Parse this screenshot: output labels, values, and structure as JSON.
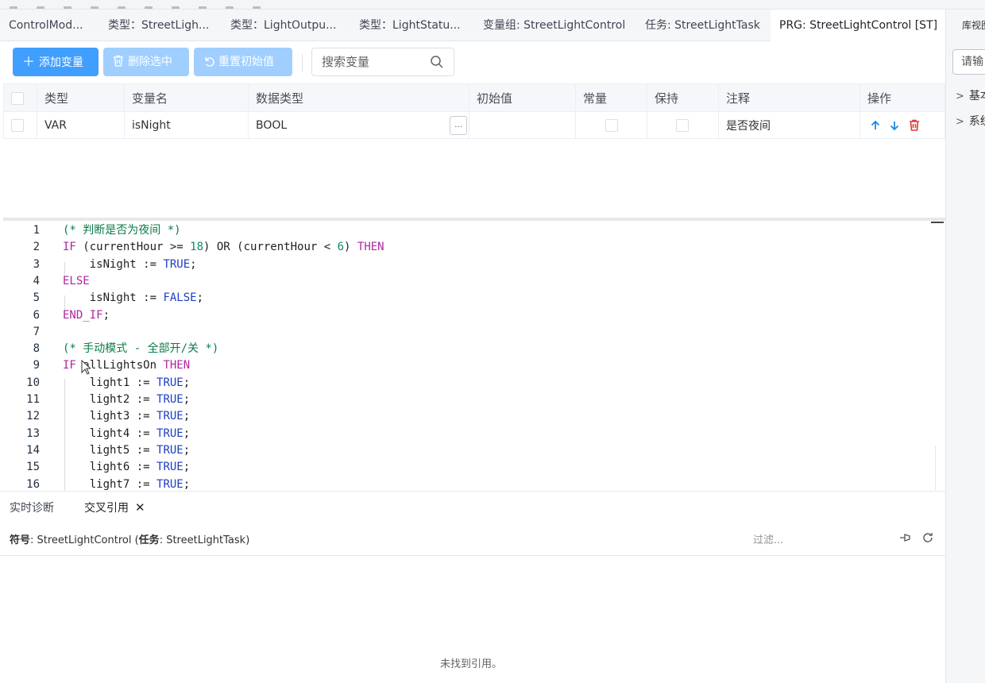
{
  "tabs": [
    {
      "label": "ControlMod..."
    },
    {
      "label": "类型：StreetLigh..."
    },
    {
      "label": "类型：LightOutpu..."
    },
    {
      "label": "类型：LightStatu..."
    },
    {
      "label": "变量组: StreetLightControl"
    },
    {
      "label": "任务: StreetLightTask"
    },
    {
      "label": "PRG: StreetLightControl [ST]"
    }
  ],
  "right_panel": {
    "title": "库视图",
    "search_placeholder": "请输",
    "items": [
      {
        "label": "基本"
      },
      {
        "label": "系统"
      }
    ]
  },
  "toolbar": {
    "add_label": "添加变量",
    "delete_label": "删除选中",
    "reset_label": "重置初始值",
    "search_placeholder": "搜索变量"
  },
  "var_table": {
    "headers": [
      "类型",
      "变量名",
      "数据类型",
      "初始值",
      "常量",
      "保持",
      "注释",
      "操作"
    ],
    "rows": [
      {
        "kind": "VAR",
        "name": "isNight",
        "dtype": "BOOL",
        "init": "",
        "comment": "是否夜间"
      }
    ]
  },
  "code": {
    "lines": [
      {
        "n": "1",
        "parts": [
          {
            "c": "cm",
            "t": "(* 判断是否为夜间 *)"
          }
        ]
      },
      {
        "n": "2",
        "parts": [
          {
            "c": "kw",
            "t": "IF"
          },
          {
            "c": "",
            "t": " (currentHour >= "
          },
          {
            "c": "num",
            "t": "18"
          },
          {
            "c": "",
            "t": ") "
          },
          {
            "c": "",
            "t": "OR"
          },
          {
            "c": "",
            "t": " (currentHour < "
          },
          {
            "c": "num",
            "t": "6"
          },
          {
            "c": "",
            "t": ") "
          },
          {
            "c": "kw",
            "t": "THEN"
          }
        ]
      },
      {
        "n": "3",
        "parts": [
          {
            "c": "",
            "t": "    isNight := "
          },
          {
            "c": "kwb",
            "t": "TRUE"
          },
          {
            "c": "",
            "t": ";"
          }
        ]
      },
      {
        "n": "4",
        "parts": [
          {
            "c": "kw",
            "t": "ELSE"
          }
        ]
      },
      {
        "n": "5",
        "parts": [
          {
            "c": "",
            "t": "    isNight := "
          },
          {
            "c": "kwb",
            "t": "FALSE"
          },
          {
            "c": "",
            "t": ";"
          }
        ]
      },
      {
        "n": "6",
        "parts": [
          {
            "c": "kw",
            "t": "END_IF"
          },
          {
            "c": "",
            "t": ";"
          }
        ]
      },
      {
        "n": "7",
        "parts": []
      },
      {
        "n": "8",
        "parts": [
          {
            "c": "cm",
            "t": "(* 手动模式 - 全部开/关 *)"
          }
        ]
      },
      {
        "n": "9",
        "parts": [
          {
            "c": "kw",
            "t": "IF"
          },
          {
            "c": "",
            "t": " allLightsOn "
          },
          {
            "c": "kw",
            "t": "THEN"
          }
        ]
      },
      {
        "n": "10",
        "parts": [
          {
            "c": "",
            "t": "    light1 := "
          },
          {
            "c": "kwb",
            "t": "TRUE"
          },
          {
            "c": "",
            "t": ";"
          }
        ]
      },
      {
        "n": "11",
        "parts": [
          {
            "c": "",
            "t": "    light2 := "
          },
          {
            "c": "kwb",
            "t": "TRUE"
          },
          {
            "c": "",
            "t": ";"
          }
        ]
      },
      {
        "n": "12",
        "parts": [
          {
            "c": "",
            "t": "    light3 := "
          },
          {
            "c": "kwb",
            "t": "TRUE"
          },
          {
            "c": "",
            "t": ";"
          }
        ]
      },
      {
        "n": "13",
        "parts": [
          {
            "c": "",
            "t": "    light4 := "
          },
          {
            "c": "kwb",
            "t": "TRUE"
          },
          {
            "c": "",
            "t": ";"
          }
        ]
      },
      {
        "n": "14",
        "parts": [
          {
            "c": "",
            "t": "    light5 := "
          },
          {
            "c": "kwb",
            "t": "TRUE"
          },
          {
            "c": "",
            "t": ";"
          }
        ]
      },
      {
        "n": "15",
        "parts": [
          {
            "c": "",
            "t": "    light6 := "
          },
          {
            "c": "kwb",
            "t": "TRUE"
          },
          {
            "c": "",
            "t": ";"
          }
        ]
      },
      {
        "n": "16",
        "parts": [
          {
            "c": "",
            "t": "    light7 := "
          },
          {
            "c": "kwb",
            "t": "TRUE"
          },
          {
            "c": "",
            "t": ";"
          }
        ]
      }
    ]
  },
  "bottom": {
    "tab_diag": "实时诊断",
    "tab_xref": "交叉引用",
    "symbol_label": "符号",
    "symbol_value": ": StreetLightControl (",
    "task_label": "任务",
    "task_value": ": StreetLightTask)",
    "filter_placeholder": "过滤...",
    "empty_text": "未找到引用。"
  },
  "colors": {
    "primary": "#409eff",
    "primary_disabled": "#a0cfff",
    "delete_red": "#e53935",
    "keyword": "#b0269e",
    "literal": "#1b3fbf",
    "number": "#0e8a6e",
    "comment": "#0a7d48"
  }
}
